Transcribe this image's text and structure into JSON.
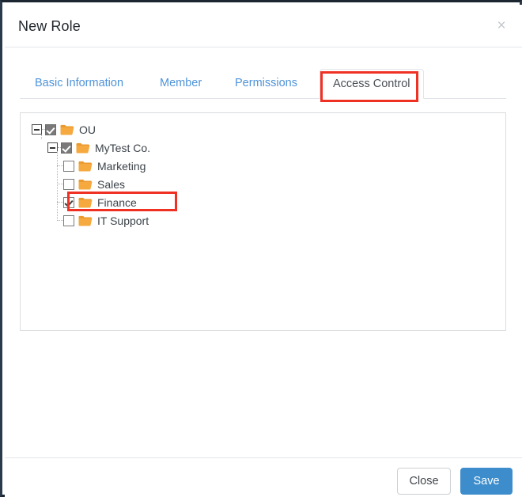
{
  "dialog": {
    "title": "New Role",
    "close_icon": "close-icon",
    "close_glyph": "×"
  },
  "tabs": [
    {
      "id": "basic",
      "label": "Basic Information",
      "active": false
    },
    {
      "id": "member",
      "label": "Member",
      "active": false
    },
    {
      "id": "permissions",
      "label": "Permissions",
      "active": false
    },
    {
      "id": "access",
      "label": "Access Control",
      "active": true
    }
  ],
  "tree": {
    "nodes": [
      {
        "label": "OU",
        "depth": 0,
        "expander": "minus",
        "checkbox": "filled",
        "folder": "folder-icon"
      },
      {
        "label": "MyTest Co.",
        "depth": 1,
        "expander": "minus",
        "checkbox": "filled",
        "folder": "folder-icon"
      },
      {
        "label": "Marketing",
        "depth": 2,
        "expander": "none",
        "checkbox": "unchecked",
        "folder": "folder-icon"
      },
      {
        "label": "Sales",
        "depth": 2,
        "expander": "none",
        "checkbox": "unchecked",
        "folder": "folder-icon"
      },
      {
        "label": "Finance",
        "depth": 2,
        "expander": "none",
        "checkbox": "checked",
        "folder": "folder-icon"
      },
      {
        "label": "IT Support",
        "depth": 2,
        "expander": "none",
        "checkbox": "unchecked",
        "folder": "folder-icon"
      }
    ]
  },
  "annotations": {
    "tab_highlight_target": "Access Control",
    "row_highlight_target": "Finance",
    "color": "#ef3124"
  },
  "footer": {
    "close_label": "Close",
    "save_label": "Save"
  },
  "colors": {
    "tab_inactive": "#4e93d9",
    "tab_active_text": "#4a4f55",
    "save_button": "#3d8dcc",
    "folder": "#f5a93f",
    "folder_dark": "#eb9a2e",
    "checkbox_filled": "#7a7a7a",
    "annotation_red": "#ef3124"
  }
}
